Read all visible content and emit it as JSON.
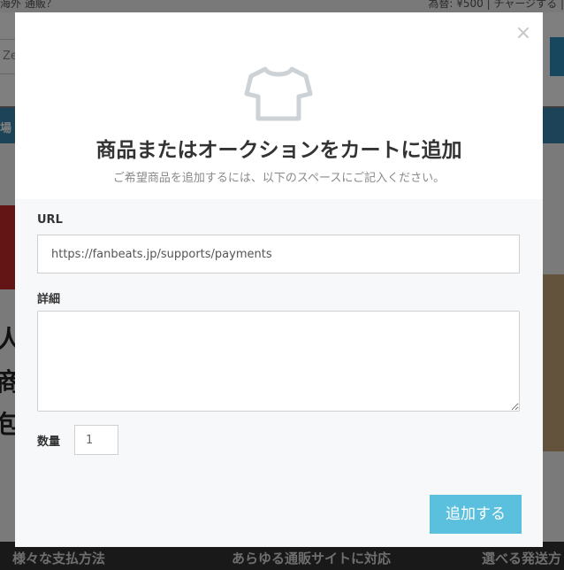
{
  "background": {
    "topbar_left": "海外 通販？",
    "topbar_right": "為替: ¥500 | チャージする |",
    "search_text": "Ze",
    "strip_text": "場",
    "left_chars": [
      "人",
      "商",
      "包"
    ],
    "red_block_text": "",
    "bottom_nav": [
      "様々な支払方法",
      "あらゆる通販サイトに対応",
      "選べる発送方"
    ]
  },
  "modal": {
    "close_label": "×",
    "icon": "tshirt-icon",
    "title": "商品またはオークションをカートに追加",
    "subtitle": "ご希望商品を追加するには、以下のスペースにご記入ください。",
    "url_label": "URL",
    "url_value": "https://fanbeats.jp/supports/payments",
    "detail_label": "詳細",
    "detail_value": "",
    "quantity_label": "数量",
    "quantity_value": "1",
    "submit_label": "追加する"
  },
  "colors": {
    "accent": "#5bc0de",
    "overlay": "rgba(0,0,0,0.5)"
  }
}
